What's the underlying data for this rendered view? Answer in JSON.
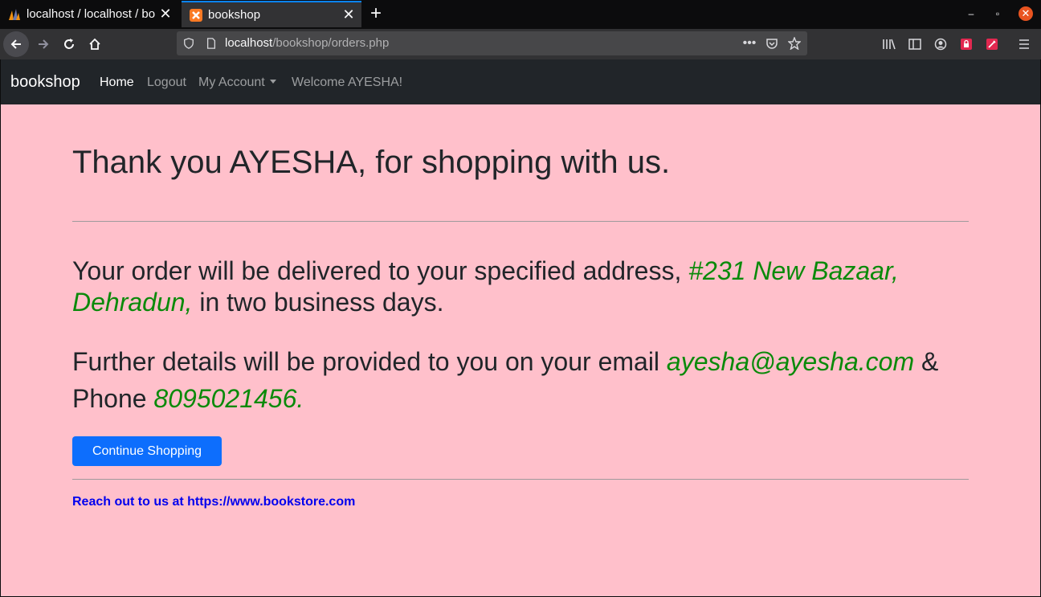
{
  "browser": {
    "tabs": [
      {
        "title": "localhost / localhost / bo",
        "active": false
      },
      {
        "title": "bookshop",
        "active": true
      }
    ],
    "url": {
      "host": "localhost",
      "path": "/bookshop/orders.php"
    }
  },
  "site": {
    "brand": "bookshop",
    "nav": {
      "home": "Home",
      "logout": "Logout",
      "account": "My Account",
      "welcome": "Welcome AYESHA!"
    }
  },
  "main": {
    "heading": "Thank you AYESHA, for shopping with us.",
    "delivery": {
      "prefix": "Your order will be delivered to your specified address, ",
      "address": "#231 New Bazaar, Dehradun,",
      "suffix": " in two business days."
    },
    "contact": {
      "prefix": "Further details will be provided to you on your email ",
      "email": "ayesha@ayesha.com",
      "middle": " & Phone ",
      "phone": "8095021456."
    },
    "continue_button": "Continue Shopping",
    "footer": "Reach out to us at https://www.bookstore.com"
  },
  "colors": {
    "page_bg": "#ffc0cb",
    "navbar_bg": "#212529",
    "highlight": "#0a8a0a",
    "button": "#0d6efd",
    "footer_link": "#0000ee"
  }
}
